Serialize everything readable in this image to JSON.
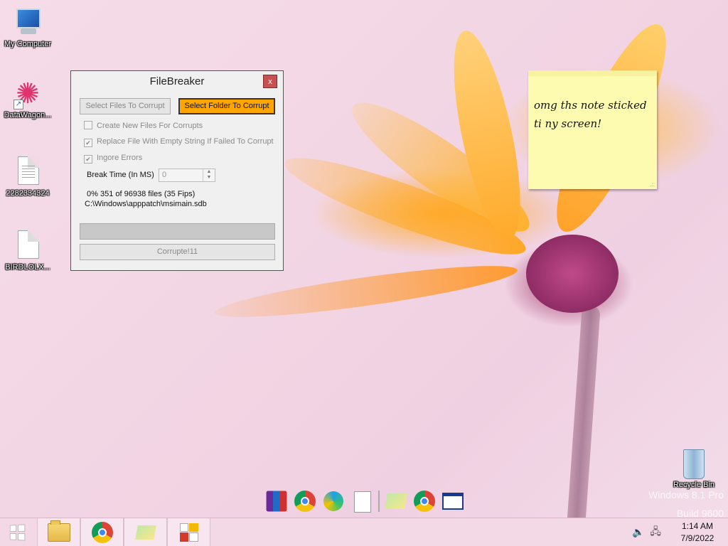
{
  "desktop_icons": [
    {
      "label": "My Computer",
      "icon": "computer-icon"
    },
    {
      "label": "DataWagon...",
      "icon": "datawagon-icon"
    },
    {
      "label": "2282334324",
      "icon": "file-icon"
    },
    {
      "label": "BIRDLOLX...",
      "icon": "file-icon"
    }
  ],
  "window": {
    "title": "FileBreaker",
    "close_label": "x",
    "select_files_label": "Select Files To Corrupt",
    "select_folder_label": "Select Folder To Corrupt",
    "options": [
      {
        "label": "Create New Files For Corrupts",
        "checked": false
      },
      {
        "label": "Replace File With Empty String If Failed To Corrupt",
        "checked": true
      },
      {
        "label": "Ingore Errors",
        "checked": true
      }
    ],
    "break_time_label": "Break Time (In MS)",
    "break_time_value": "0",
    "status_text": "0% 351 of 96938 files (35 Fips)",
    "current_file": "C:\\Windows\\apppatch\\msimain.sdb",
    "progress_fraction": 0,
    "corrupt_label": "Corrupte!11"
  },
  "sticky_note": {
    "text_line1": "omg ths note sticked",
    "text_line2": "ti ny screen!",
    "grip": ".::"
  },
  "recycle_bin": {
    "label": "Recycle Bin"
  },
  "watermark": {
    "line1": "Windows 8.1 Pro",
    "line2": "Build 9600"
  },
  "taskbar": {
    "clock_time": "1:14 AM",
    "clock_date": "7/9/2022"
  },
  "colors": {
    "accent_orange": "#ffa500",
    "sticky": "#fdfbaf",
    "close_red": "#c75050"
  }
}
